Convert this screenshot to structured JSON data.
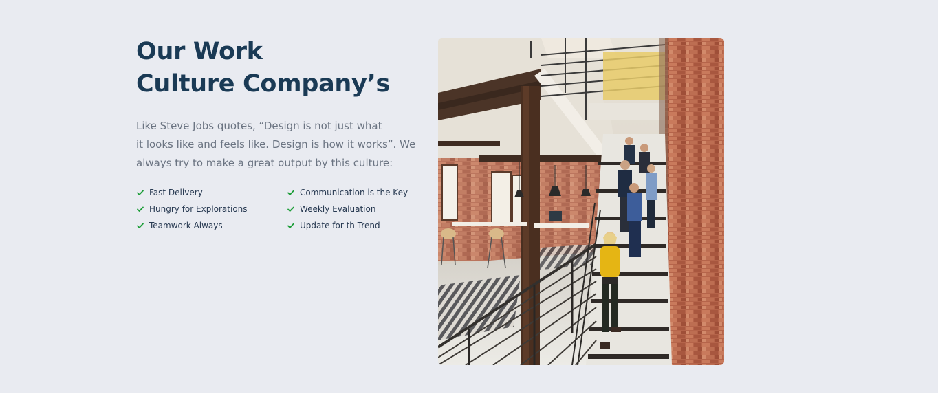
{
  "heading": {
    "line1": "Our Work",
    "line2": "Culture Company’s"
  },
  "description": {
    "line1": "Like Steve Jobs quotes, “Design is not just what",
    "line2": "it looks like and feels like. Design is how it works”. We",
    "line3": "always try to make a great output by this culture:"
  },
  "features": [
    {
      "label": "Fast Delivery",
      "icon": "check-icon"
    },
    {
      "label": "Communication is the Key",
      "icon": "check-icon"
    },
    {
      "label": "Hungry for Explorations",
      "icon": "check-icon"
    },
    {
      "label": "Weekly Evaluation",
      "icon": "check-icon"
    },
    {
      "label": "Teamwork Always",
      "icon": "check-icon"
    },
    {
      "label": "Update for th Trend",
      "icon": "check-icon"
    }
  ],
  "colors": {
    "background": "#e9ebf1",
    "heading": "#1a3a55",
    "body_text": "#6b7482",
    "check": "#1e9e3a"
  },
  "image": {
    "subject": "office-staircase-photo"
  }
}
